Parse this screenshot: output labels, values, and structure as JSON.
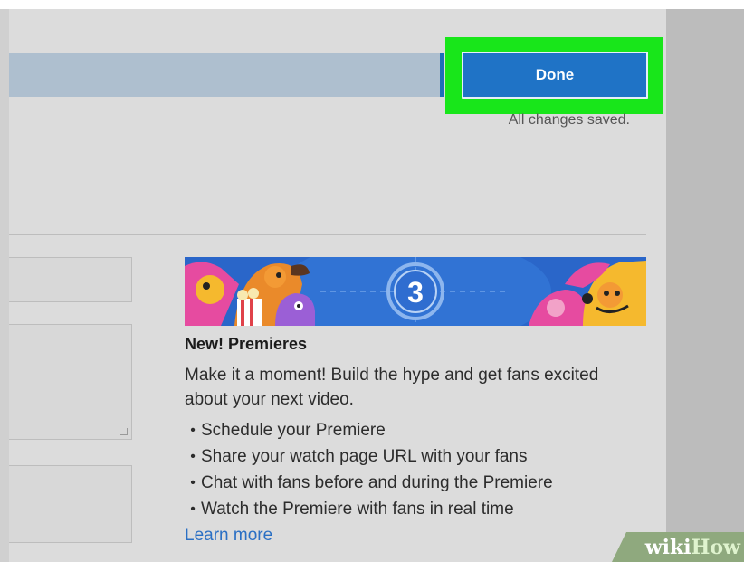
{
  "toolbar": {
    "done_label": "Done",
    "save_status": "All changes saved."
  },
  "promo": {
    "banner_number": "3",
    "title": "New! Premieres",
    "description": "Make it a moment! Build the hype and get fans excited about your next video.",
    "bullets": [
      "Schedule your Premiere",
      "Share your watch page URL with your fans",
      "Chat with fans before and during the Premiere",
      "Watch the Premiere with fans in real time"
    ],
    "learn_more": "Learn more"
  },
  "watermark": {
    "part1": "wiki",
    "part2": "How"
  },
  "colors": {
    "accent": "#1f73c6",
    "highlight": "#18e61a",
    "link": "#2a6fc4"
  }
}
